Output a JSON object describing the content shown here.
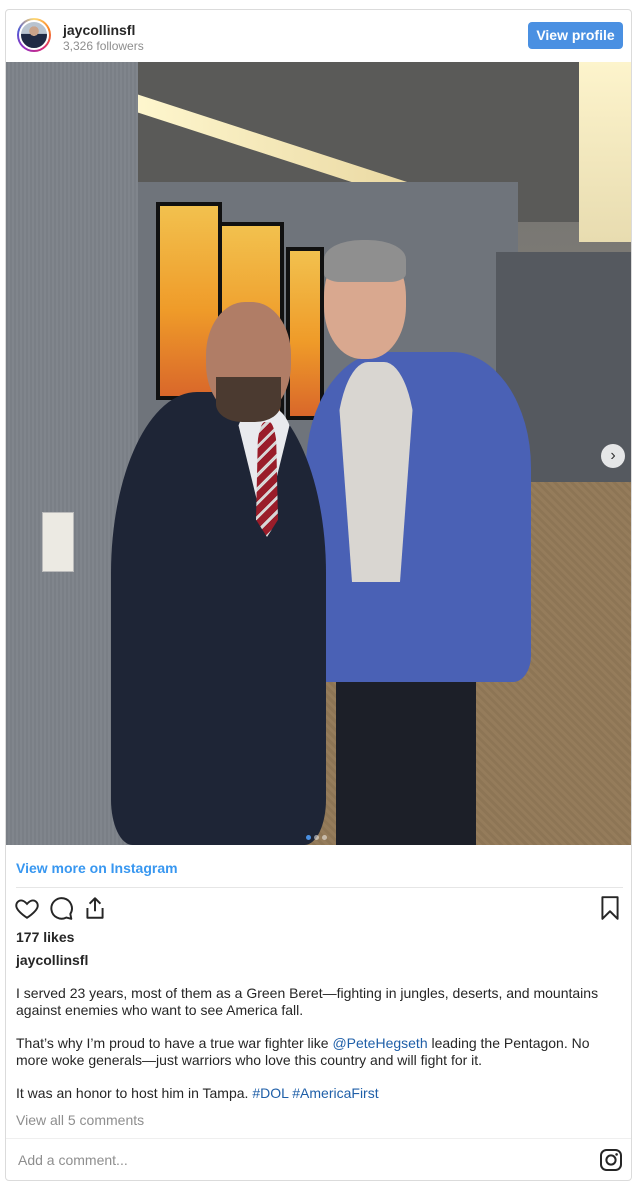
{
  "header": {
    "username": "jaycollinsfl",
    "followers": "3,326 followers",
    "view_profile_label": "View profile"
  },
  "photo": {
    "carousel_next_glyph": "›",
    "carousel_count": 3,
    "carousel_active_index": 0
  },
  "view_more": "View more on Instagram",
  "actions": {
    "icons": [
      "heart-icon",
      "comment-icon",
      "share-icon",
      "bookmark-icon"
    ]
  },
  "likes": "177 likes",
  "author": "jaycollinsfl",
  "caption": {
    "p1": "I served 23 years, most of them as a Green Beret—fighting in jungles, deserts, and mountains against enemies who want to see America fall.",
    "p2_before": "That’s why I’m proud to have a true war fighter like ",
    "p2_mention": "@PeteHegseth",
    "p2_after": " leading the Pentagon. No more woke generals—just warriors who love this country and will fight for it.",
    "p3_before": "It was an honor to host him in Tampa. ",
    "tag1": "#DOL",
    "tag2": "#AmericaFirst"
  },
  "comments_link": "View all 5 comments",
  "comment_input": {
    "placeholder": "Add a comment..."
  },
  "colors": {
    "accent": "#4a90e2",
    "link": "#3897f0",
    "tag": "#1f5fa8"
  }
}
